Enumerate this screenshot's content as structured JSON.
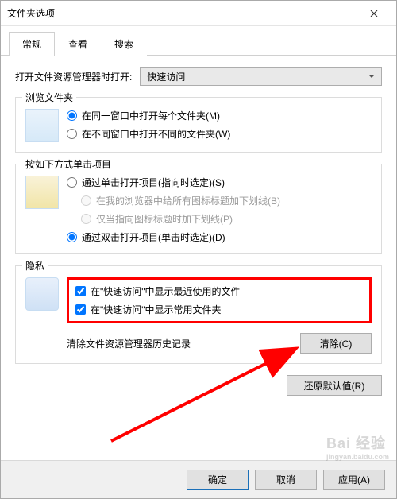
{
  "window": {
    "title": "文件夹选项"
  },
  "tabs": {
    "general": "常规",
    "view": "查看",
    "search": "搜索"
  },
  "openWith": {
    "label": "打开文件资源管理器时打开:",
    "selected": "快速访问"
  },
  "browse": {
    "legend": "浏览文件夹",
    "sameWindow": "在同一窗口中打开每个文件夹(M)",
    "newWindow": "在不同窗口中打开不同的文件夹(W)"
  },
  "click": {
    "legend": "按如下方式单击项目",
    "singleClick": "通过单击打开项目(指向时选定)(S)",
    "underlineBrowser": "在我的浏览器中给所有图标标题加下划线(B)",
    "underlinePoint": "仅当指向图标标题时加下划线(P)",
    "doubleClick": "通过双击打开项目(单击时选定)(D)"
  },
  "privacy": {
    "legend": "隐私",
    "recentFiles": "在\"快速访问\"中显示最近使用的文件",
    "frequentFolders": "在\"快速访问\"中显示常用文件夹",
    "clearHistoryLabel": "清除文件资源管理器历史记录",
    "clearButton": "清除(C)"
  },
  "restoreDefaults": "还原默认值(R)",
  "footer": {
    "ok": "确定",
    "cancel": "取消",
    "apply": "应用(A)"
  },
  "watermark": {
    "brand": "Bai 经验",
    "url": "jingyan.baidu.com"
  }
}
